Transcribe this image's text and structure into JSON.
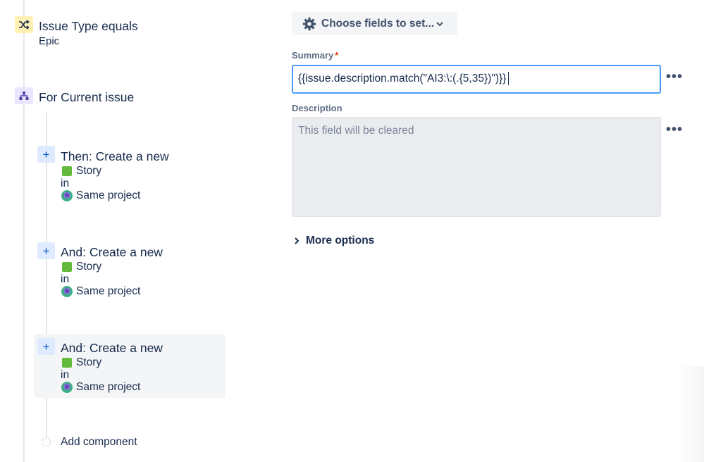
{
  "condition": {
    "title": "Issue Type equals",
    "value": "Epic"
  },
  "branch": {
    "title": "For Current issue"
  },
  "actions": [
    {
      "title": "Then: Create a new",
      "issue_type": "Story",
      "in_label": "in",
      "project": "Same project"
    },
    {
      "title": "And: Create a new",
      "issue_type": "Story",
      "in_label": "in",
      "project": "Same project"
    },
    {
      "title": "And: Create a new",
      "issue_type": "Story",
      "in_label": "in",
      "project": "Same project"
    }
  ],
  "add_component": "Add component",
  "panel": {
    "choose_fields_label": "Choose fields to set...",
    "summary_label": "Summary",
    "required_mark": "*",
    "summary_value": "{{issue.description.match(\"AI3:\\:(.{5,35})\")}}",
    "description_label": "Description",
    "description_placeholder": "This field will be cleared",
    "more_options": "More options",
    "more_menu_glyph": "•••"
  },
  "colors": {
    "condition_icon_bg": "#FFF0B3",
    "branch_icon_bg": "#EAE6FF",
    "plus_bg": "#DEEBFF",
    "story_green": "#63BA3C",
    "focus_blue": "#4C9AFF",
    "selected_card_bg": "#F4F5F7"
  }
}
